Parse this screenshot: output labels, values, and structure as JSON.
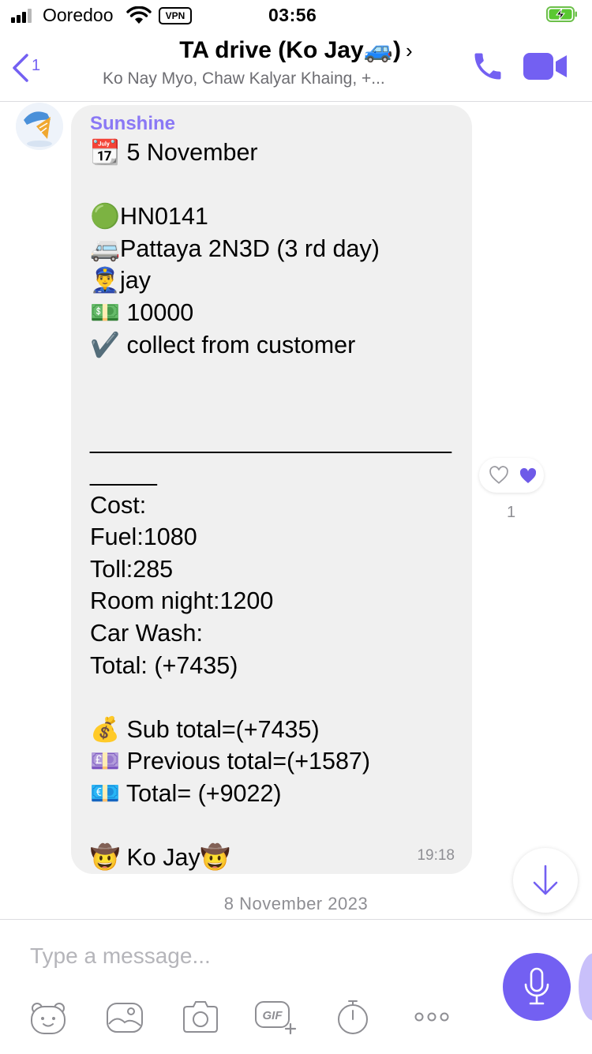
{
  "status_bar": {
    "carrier": "Ooredoo",
    "vpn_label": "VPN",
    "time": "03:56",
    "battery_icon": "battery-charging-icon"
  },
  "header": {
    "back_count": "1",
    "title": "TA drive (Ko Jay🚙)",
    "chevron": "›",
    "subtitle": "Ko Nay Myo, Chaw Kalyar Khaing, +..."
  },
  "message": {
    "sender": "Sunshine",
    "text": "📆 5 November\n\n🟢HN0141\n🚐Pattaya 2N3D (3 rd day)\n👮‍♂️jay\n💵 10000\n✔️ collect from customer\n\n\n________________________________\nCost:\nFuel:1080\nToll:285\nRoom night:1200\nCar Wash:\nTotal: (+7435)\n\n💰 Sub total=(+7435)\n💷 Previous total=(+1587)\n💶 Total= (+9022)\n\n🤠 Ko Jay🤠",
    "time": "19:18",
    "like_count": "1"
  },
  "date_separator": "8 November 2023",
  "composer": {
    "placeholder": "Type a message...",
    "value": ""
  },
  "colors": {
    "accent": "#7360f2",
    "sender_name": "#8a78f5",
    "bubble": "#f0f0f0"
  },
  "toolbar_icons": [
    "sticker-icon",
    "gallery-icon",
    "camera-icon",
    "gif-icon",
    "timer-icon",
    "more-icon"
  ]
}
